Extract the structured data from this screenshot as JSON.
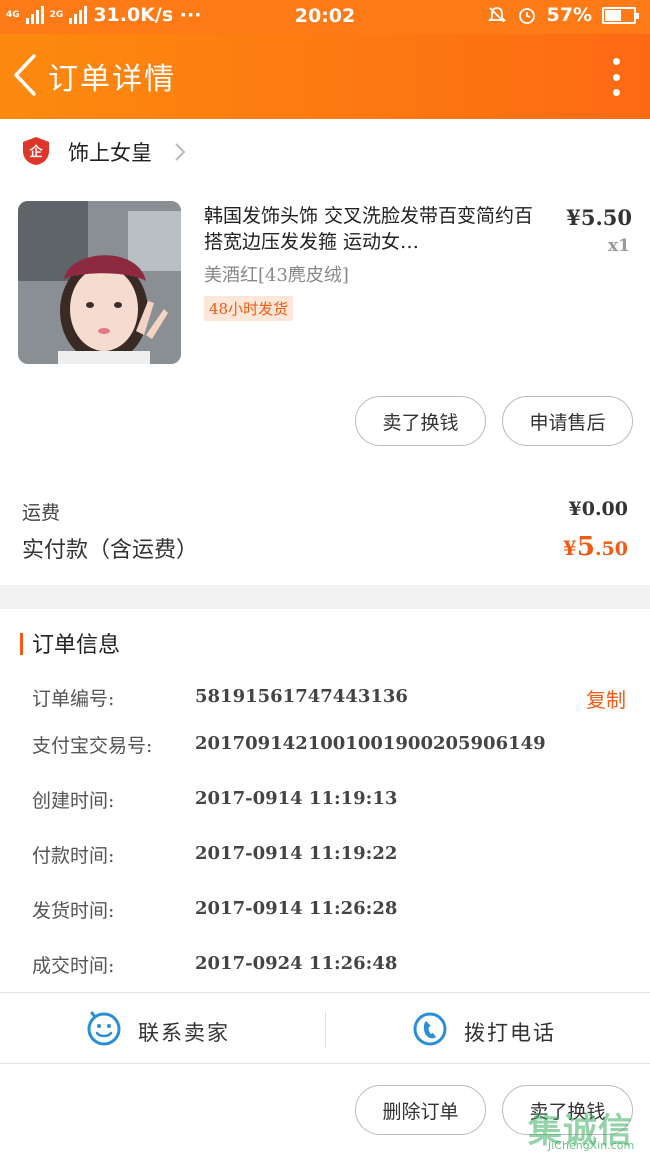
{
  "status_bar": {
    "network_left": "4G",
    "network_mid": "2G",
    "speed": "31.0K/s ···",
    "time": "20:02",
    "battery": "57%",
    "battery_level": 0.57
  },
  "header": {
    "title": "订单详情"
  },
  "shop": {
    "logo_text": "企",
    "name": "饰上女皇"
  },
  "product": {
    "title": "韩国发饰头饰 交叉洗脸发带百变简约百搭宽边压发发箍 运动女…",
    "sku": "美酒红[43麂皮绒]",
    "badge": "48小时发货",
    "price": "¥5.50",
    "quantity": "x1"
  },
  "item_actions": {
    "sell_label": "卖了换钱",
    "aftersale_label": "申请售后"
  },
  "fees": {
    "shipping_label": "运费",
    "shipping_value": "¥0.00",
    "paid_label": "实付款（含运费）",
    "paid_currency": "¥",
    "paid_int": "5",
    "paid_dec": ".50"
  },
  "order_info": {
    "title": "订单信息",
    "copy_label": "复制",
    "rows": [
      {
        "label": "订单编号:",
        "value": "58191561747443136"
      },
      {
        "label": "支付宝交易号:",
        "value": "2017091421001001900205906149"
      },
      {
        "label": "创建时间:",
        "value": "2017-0914  11:19:13"
      },
      {
        "label": "付款时间:",
        "value": "2017-0914  11:19:22"
      },
      {
        "label": "发货时间:",
        "value": "2017-0914  11:26:28"
      },
      {
        "label": "成交时间:",
        "value": "2017-0924  11:26:48"
      }
    ]
  },
  "contact": {
    "seller_label": "联系卖家",
    "call_label": "拨打电话"
  },
  "footer": {
    "delete_label": "删除订单",
    "sell_label": "卖了换钱"
  },
  "watermark": {
    "text": "集诚信",
    "url": "JiChengXin.com"
  },
  "colors": {
    "accent": "#fe7a16",
    "price_orange": "#f35b14"
  }
}
